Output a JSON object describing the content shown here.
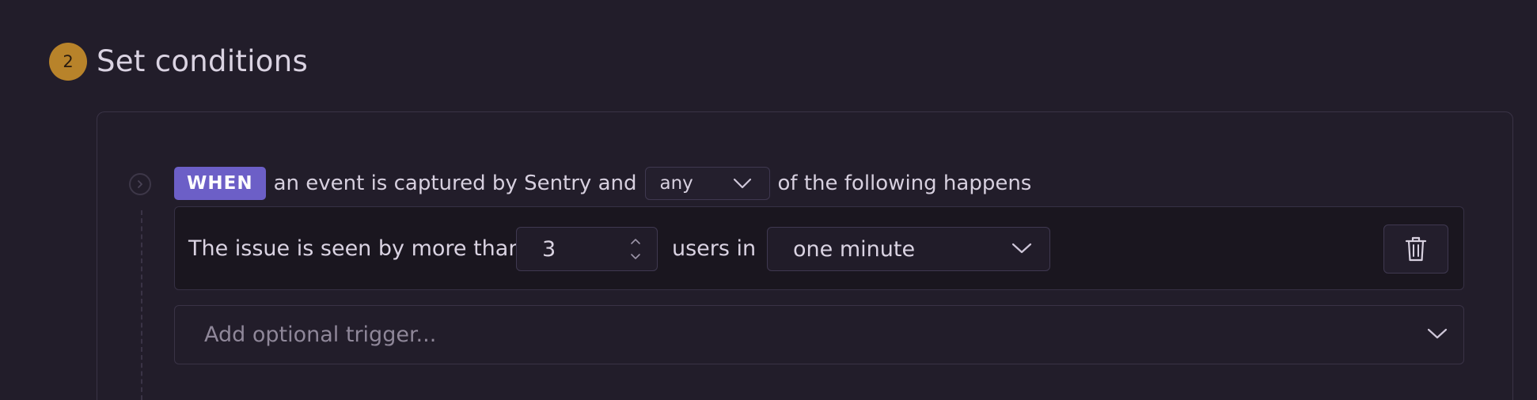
{
  "step": {
    "number": "2",
    "title": "Set conditions"
  },
  "when_row": {
    "tag": "WHEN",
    "text_before": "an event is captured by Sentry and",
    "match_value": "any",
    "text_after": "of the following happens"
  },
  "condition": {
    "prefix": "The issue is seen by more than",
    "count": "3",
    "middle": "users in",
    "interval": "one minute"
  },
  "add_trigger": {
    "placeholder": "Add optional trigger..."
  },
  "icons": {
    "timeline": "chevron-right-circle-icon",
    "match_select": "chevron-down-icon",
    "stepper": "up-down-stepper-icon",
    "interval_select": "chevron-down-icon",
    "delete": "trash-icon",
    "add_trigger": "chevron-down-icon"
  },
  "colors": {
    "background": "#221d2a",
    "step_badge": "#b8832a",
    "when_tag": "#6c5fc7"
  }
}
